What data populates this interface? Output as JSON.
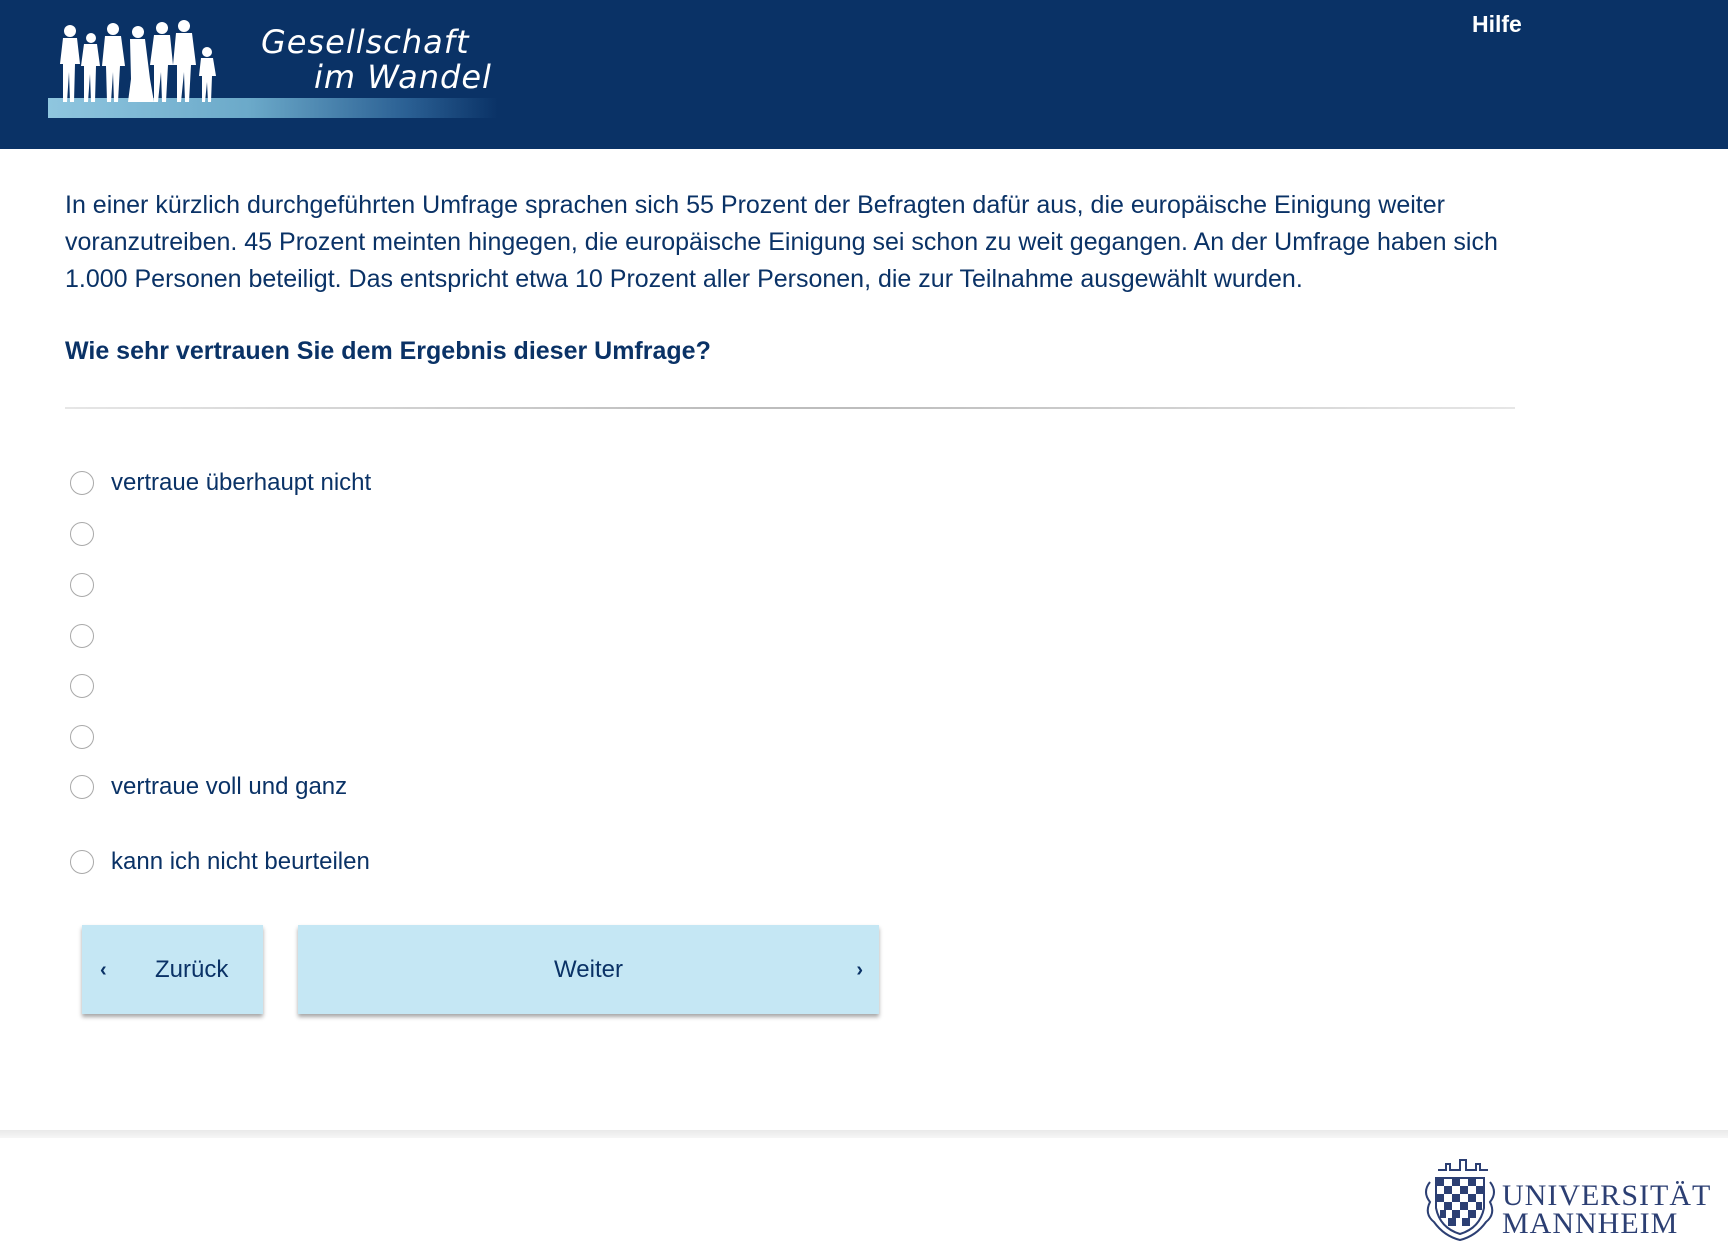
{
  "header": {
    "logo_line1": "Gesellschaft",
    "logo_line2": "im Wandel",
    "help_label": "Hilfe"
  },
  "intro_text": "In einer kürzlich durchgeführten Umfrage sprachen sich 55 Prozent der Befragten dafür aus, die europäische Einigung weiter voranzutreiben. 45 Prozent meinten hingegen, die europäische Einigung sei schon zu weit gegangen. An der Umfrage haben sich 1.000 Personen beteiligt. Das entspricht etwa 10 Prozent aller Personen, die zur Teilnahme ausgewählt wurden.",
  "question": "Wie sehr vertrauen Sie dem Ergebnis dieser Umfrage?",
  "options": [
    {
      "label": "vertraue überhaupt nicht",
      "selected": false
    },
    {
      "label": "",
      "selected": false
    },
    {
      "label": "",
      "selected": false
    },
    {
      "label": "",
      "selected": false
    },
    {
      "label": "",
      "selected": false
    },
    {
      "label": "",
      "selected": false
    },
    {
      "label": "vertraue voll und ganz",
      "selected": false
    },
    {
      "label": "kann ich nicht beurteilen",
      "selected": false
    }
  ],
  "buttons": {
    "back_label": "Zurück",
    "next_label": "Weiter",
    "back_icon": "chevron-left-icon",
    "next_icon": "chevron-right-icon"
  },
  "footer": {
    "university_line1": "UNIVERSITÄT",
    "university_line2": "MANNHEIM"
  },
  "colors": {
    "header_bg": "#0a3266",
    "text": "#0a3266",
    "button_bg": "#c5e7f4"
  }
}
